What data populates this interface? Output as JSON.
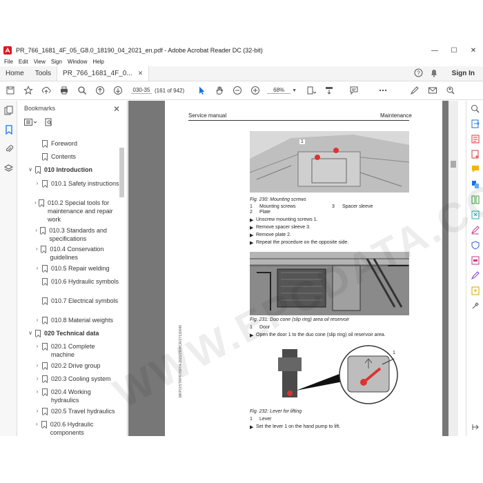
{
  "window": {
    "title": "PR_766_1681_4F_05_G8.0_18190_04_2021_en.pdf - Adobe Acrobat Reader DC (32-bit)"
  },
  "menu": [
    "File",
    "Edit",
    "View",
    "Sign",
    "Window",
    "Help"
  ],
  "tabs": {
    "home": "Home",
    "tools": "Tools",
    "document": "PR_766_1681_4F_0..."
  },
  "header": {
    "signin": "Sign In"
  },
  "toolbar": {
    "page_label": "030-35",
    "page_count": "(161 of 942)",
    "zoom": "68%"
  },
  "bookmarks": {
    "title": "Bookmarks",
    "items": [
      {
        "label": "Foreword"
      },
      {
        "label": "Contents"
      },
      {
        "label": "010 Introduction"
      },
      {
        "label": "010.1 Safety instructions"
      },
      {
        "label": "010.2 Special tools for maintenance and repair work"
      },
      {
        "label": "010.3 Standards and specifications"
      },
      {
        "label": "010.4 Conservation guidelines"
      },
      {
        "label": "010.5 Repair welding"
      },
      {
        "label": "010.6 Hydraulic symbols"
      },
      {
        "label": "010.7 Electrical symbols"
      },
      {
        "label": "010.8 Material weights"
      },
      {
        "label": "020 Technical data"
      },
      {
        "label": "020.1 Complete machine"
      },
      {
        "label": "020.2 Drive group"
      },
      {
        "label": "020.3 Cooling system"
      },
      {
        "label": "020.4 Working hydraulics"
      },
      {
        "label": "020.5 Travel hydraulics"
      },
      {
        "label": "020.6 Hydraulic components"
      }
    ]
  },
  "pdf": {
    "header_left": "Service manual",
    "header_right": "Maintenance",
    "fig230": {
      "caption": "Fig. 230: Mounting screws",
      "callout": "1",
      "legend": [
        {
          "num": "1",
          "text": "Mounting screws"
        },
        {
          "num": "2",
          "text": "Plate"
        },
        {
          "num": "3",
          "text": "Spacer sleeve"
        }
      ],
      "steps": [
        "Unscrew mounting screws 1.",
        "Remove spacer sleeve 3.",
        "Remove plate 2.",
        "Repeat the procedure on the opposite side."
      ]
    },
    "fig231": {
      "caption": "Fig. 231: Duo cone (slip ring) area oil reservoir",
      "legend": [
        {
          "num": "1",
          "text": "Door"
        }
      ],
      "steps": [
        "Open the door 1 to the duo cone (slip ring) oil reservoir area."
      ]
    },
    "fig232": {
      "caption": "Fig. 232: Lever for lifting",
      "callout": "1",
      "legend": [
        {
          "num": "1",
          "text": "Lever"
        }
      ],
      "steps": [
        "Set the lever 1 on the hand pump to lift."
      ]
    },
    "side_code": "MKP/2/STRPR766/04-2021/ZR/PCR/27130046"
  },
  "watermark": "WWW.EPCDATA.COM",
  "colors": {
    "accent": "#1473e6",
    "red": "#e03a2f"
  }
}
